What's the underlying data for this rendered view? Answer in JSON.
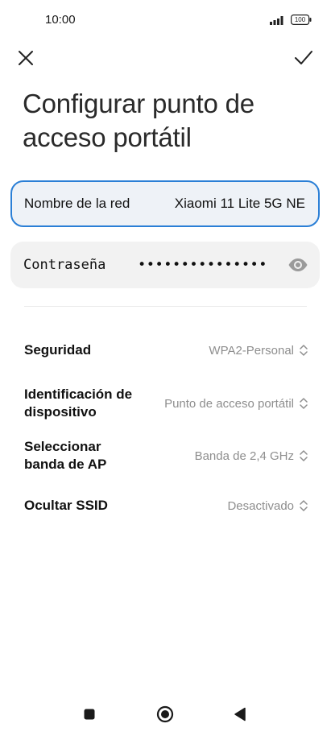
{
  "status_bar": {
    "time": "10:00",
    "battery": "100"
  },
  "title": "Configurar punto de acceso portátil",
  "fields": {
    "ssid": {
      "label": "Nombre de la red",
      "value": "Xiaomi 11 Lite 5G NE"
    },
    "password": {
      "label": "Contraseña",
      "value": "•••••••••••••••"
    }
  },
  "settings": [
    {
      "label": "Seguridad",
      "value": "WPA2-Personal"
    },
    {
      "label": "Identificación de dispositivo",
      "value": "Punto de acceso portátil"
    },
    {
      "label": "Seleccionar banda de AP",
      "value": "Banda de 2,4 GHz"
    },
    {
      "label": "Ocultar SSID",
      "value": "Desactivado"
    }
  ],
  "colors": {
    "accent": "#2a7fd6",
    "field_bg": "#f2f2f2",
    "secondary_text": "#8e8e8e"
  },
  "icons": {
    "close": "close-icon",
    "confirm": "checkmark-icon",
    "password_visibility": "eye-icon",
    "picker": "chevron-up-down-icon",
    "nav_recents": "square-icon",
    "nav_home": "circle-icon",
    "nav_back": "triangle-back-icon"
  }
}
